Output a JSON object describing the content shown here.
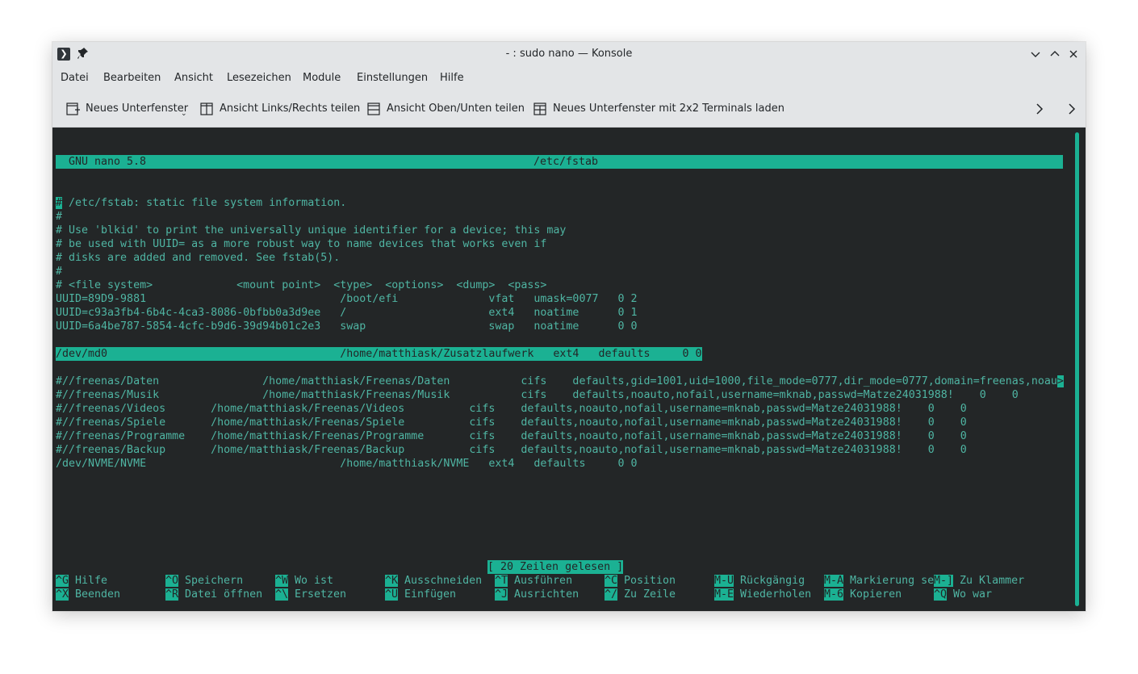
{
  "window": {
    "title": "- : sudo nano — Konsole"
  },
  "menubar": {
    "items": [
      "Datei",
      "Bearbeiten",
      "Ansicht",
      "Lesezeichen",
      "Module",
      "Einstellungen",
      "Hilfe"
    ]
  },
  "toolbar": {
    "new_tab": "Neues Unterfenster",
    "split_lr": "Ansicht Links/Rechts teilen",
    "split_tb": "Ansicht Oben/Unten teilen",
    "grid_layout": "Neues Unterfenster mit 2x2 Terminals laden"
  },
  "nano": {
    "version": "GNU nano 5.8",
    "filename": "/etc/fstab",
    "lines": [
      " /etc/fstab: static file system information.",
      "#",
      "# Use 'blkid' to print the universally unique identifier for a device; this may",
      "# be used with UUID= as a more robust way to name devices that works even if",
      "# disks are added and removed. See fstab(5).",
      "#",
      "# <file system>             <mount point>  <type>  <options>  <dump>  <pass>",
      "UUID=89D9-9881                              /boot/efi              vfat   umask=0077   0 2",
      "UUID=c93a3fb4-6b4c-4ca3-8086-0bfbb0a3d9ee   /                      ext4   noatime      0 1",
      "UUID=6a4be787-5854-4cfc-b9d6-39d94b01c2e3   swap                   swap   noatime      0 0",
      "",
      "/dev/md0                                    /home/matthiask/Zusatzlaufwerk   ext4   defaults     0 0",
      "",
      "#//freenas/Daten                /home/matthiask/Freenas/Daten           cifs    defaults,gid=1001,uid=1000,file_mode=0777,dir_mode=0777,domain=freenas,noau",
      "#//freenas/Musik                /home/matthiask/Freenas/Musik           cifs    defaults,noauto,nofail,username=mknab,passwd=Matze24031988!    0    0",
      "#//freenas/Videos       /home/matthiask/Freenas/Videos          cifs    defaults,noauto,nofail,username=mknab,passwd=Matze24031988!    0    0",
      "#//freenas/Spiele       /home/matthiask/Freenas/Spiele          cifs    defaults,noauto,nofail,username=mknab,passwd=Matze24031988!    0    0",
      "#//freenas/Programme    /home/matthiask/Freenas/Programme       cifs    defaults,noauto,nofail,username=mknab,passwd=Matze24031988!    0    0",
      "#//freenas/Backup       /home/matthiask/Freenas/Backup          cifs    defaults,noauto,nofail,username=mknab,passwd=Matze24031988!    0    0",
      "/dev/NVME/NVME                              /home/matthiask/NVME   ext4   defaults     0 0"
    ],
    "cursor_char": "#",
    "overflow_char": ">",
    "status": "[ 20 Zeilen gelesen ]",
    "shortcuts_row1": [
      {
        "key": "^G",
        "label": "Hilfe"
      },
      {
        "key": "^O",
        "label": "Speichern"
      },
      {
        "key": "^W",
        "label": "Wo ist"
      },
      {
        "key": "^K",
        "label": "Ausschneiden"
      },
      {
        "key": "^T",
        "label": "Ausführen"
      },
      {
        "key": "^C",
        "label": "Position"
      },
      {
        "key": "M-U",
        "label": "Rückgängig"
      },
      {
        "key": "M-A",
        "label": "Markierung se"
      },
      {
        "key": "M-]",
        "label": "Zu Klammer"
      }
    ],
    "shortcuts_row2": [
      {
        "key": "^X",
        "label": "Beenden"
      },
      {
        "key": "^R",
        "label": "Datei öffnen"
      },
      {
        "key": "^\\",
        "label": "Ersetzen"
      },
      {
        "key": "^U",
        "label": "Einfügen"
      },
      {
        "key": "^J",
        "label": "Ausrichten"
      },
      {
        "key": "^/",
        "label": "Zu Zeile"
      },
      {
        "key": "M-E",
        "label": "Wiederholen"
      },
      {
        "key": "M-6",
        "label": "Kopieren"
      },
      {
        "key": "^Q",
        "label": "Wo war"
      }
    ]
  },
  "colors": {
    "accent": "#1bb193",
    "text": "#4fb5a3",
    "terminal_bg": "#232627"
  }
}
